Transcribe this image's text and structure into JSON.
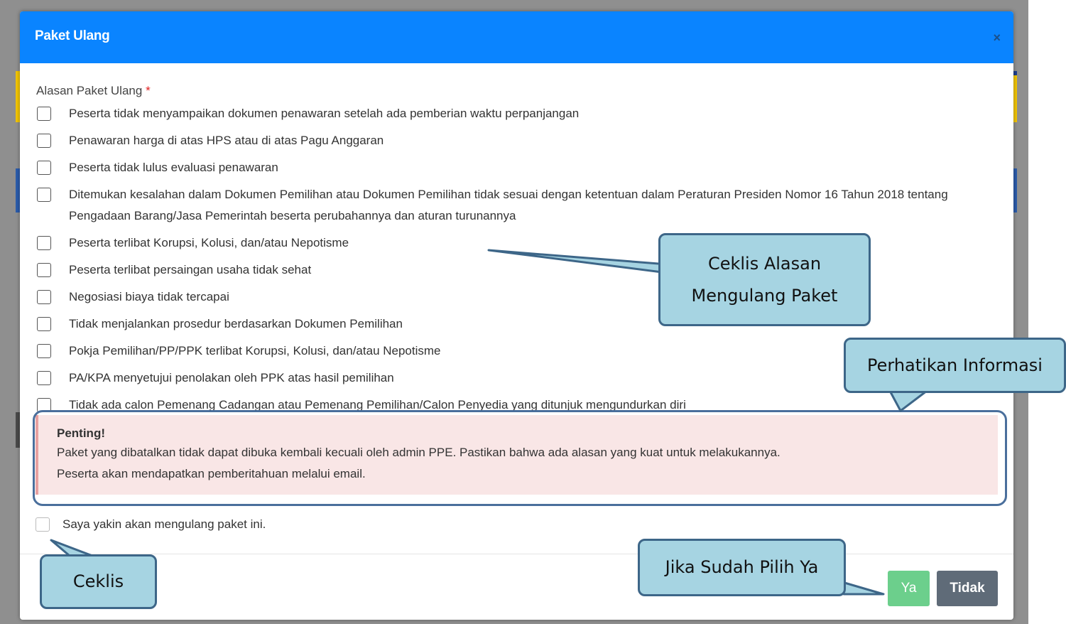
{
  "modal": {
    "title": "Paket Ulang",
    "close_glyph": "×",
    "field_label": "Alasan Paket Ulang",
    "required_mark": "*",
    "reasons": [
      "Peserta tidak menyampaikan dokumen penawaran setelah ada pemberian waktu perpanjangan",
      "Penawaran harga di atas HPS atau di atas Pagu Anggaran",
      "Peserta tidak lulus evaluasi penawaran",
      "Ditemukan kesalahan dalam Dokumen Pemilihan atau Dokumen Pemilihan tidak sesuai dengan ketentuan dalam Peraturan Presiden Nomor 16 Tahun 2018 tentang Pengadaan Barang/Jasa Pemerintah beserta perubahannya dan aturan turunannya",
      "Peserta terlibat Korupsi, Kolusi, dan/atau Nepotisme",
      "Peserta terlibat persaingan usaha tidak sehat",
      "Negosiasi biaya tidak tercapai",
      "Tidak menjalankan prosedur berdasarkan Dokumen Pemilihan",
      "Pokja Pemilihan/PP/PPK terlibat Korupsi, Kolusi, dan/atau Nepotisme",
      "PA/KPA menyetujui penolakan oleh PPK atas hasil pemilihan",
      "Tidak ada calon Pemenang Cadangan atau Pemenang Pemilihan/Calon Penyedia yang ditunjuk mengundurkan diri"
    ],
    "alert": {
      "title": "Penting!",
      "line1": "Paket yang dibatalkan tidak dapat dibuka kembali kecuali oleh admin PPE. Pastikan bahwa ada alasan yang kuat untuk melakukannya.",
      "line2": "Peserta akan mendapatkan pemberitahuan melalui email."
    },
    "confirm_label": "Saya yakin akan mengulang paket ini.",
    "yes_label": "Ya",
    "no_label": "Tidak"
  },
  "callouts": {
    "reasons_line1": "Ceklis Alasan",
    "reasons_line2": "Mengulang Paket",
    "info": "Perhatikan Informasi",
    "check": "Ceklis",
    "yes": "Jika Sudah Pilih Ya"
  },
  "colors": {
    "header": "#0a84ff",
    "callout_fill": "#a6d4e2",
    "callout_border": "#3d6688",
    "yes_button": "#6ccf8c",
    "no_button": "#5f6b78",
    "alert_bg": "#f9e6e6"
  }
}
